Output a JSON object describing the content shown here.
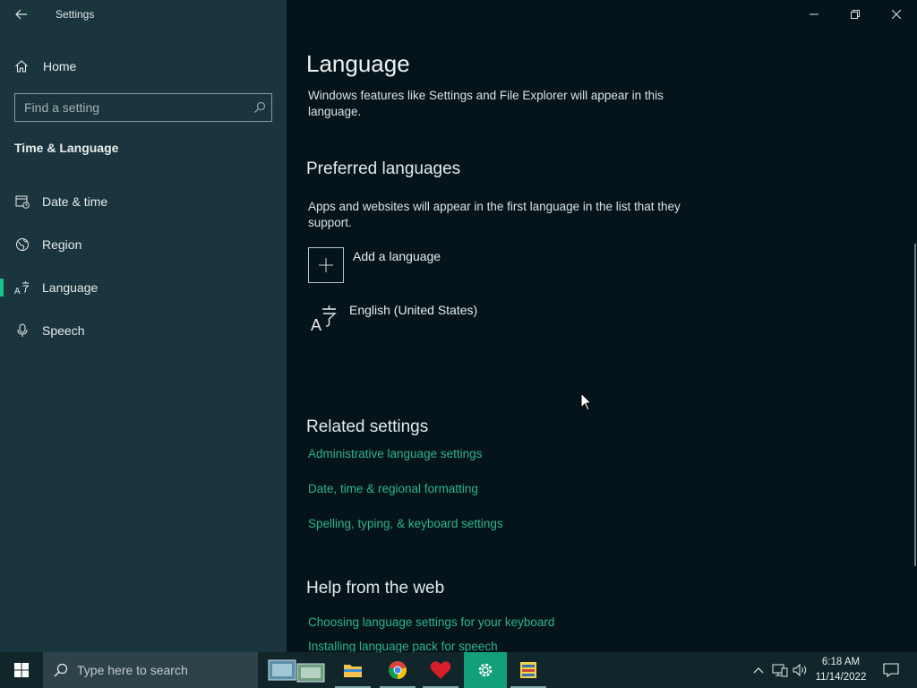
{
  "window": {
    "title": "Settings"
  },
  "sidebar": {
    "home_label": "Home",
    "search_placeholder": "Find a setting",
    "section_title": "Time & Language",
    "items": [
      {
        "label": "Date & time",
        "icon": "date-time-icon"
      },
      {
        "label": "Region",
        "icon": "globe-icon"
      },
      {
        "label": "Language",
        "icon": "language-icon",
        "selected": true
      },
      {
        "label": "Speech",
        "icon": "microphone-icon"
      }
    ]
  },
  "main": {
    "title": "Language",
    "intro": "Windows features like Settings and File Explorer will appear in this language.",
    "preferred": {
      "heading": "Preferred languages",
      "description": "Apps and websites will appear in the first language in the list that they support.",
      "add_label": "Add a language",
      "languages": [
        "English (United States)"
      ]
    },
    "related": {
      "heading": "Related settings",
      "links": [
        "Administrative language settings",
        "Date, time & regional formatting",
        "Spelling, typing, & keyboard settings"
      ]
    },
    "help": {
      "heading": "Help from the web",
      "links": [
        "Choosing language settings for your keyboard",
        "Installing language pack for speech"
      ]
    }
  },
  "taskbar": {
    "search_placeholder": "Type here to search",
    "apps": [
      "task-view",
      "file-explorer",
      "chrome",
      "heart-app",
      "settings",
      "notepad"
    ],
    "clock": {
      "time": "6:18 AM",
      "date": "11/14/2022"
    }
  },
  "colors": {
    "accent": "#17c38f",
    "link": "#2fb58a",
    "sidebar_bg": "#18333b",
    "main_bg": "#04141a",
    "taskbar_bg": "#10262b"
  }
}
